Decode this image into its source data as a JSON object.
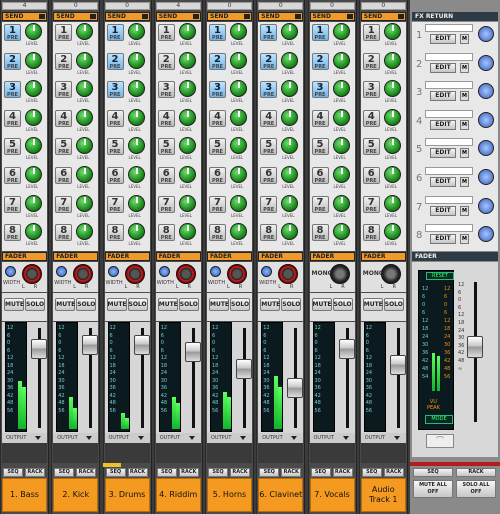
{
  "channels": [
    {
      "top": "4",
      "name": "1. Bass",
      "pan": "width",
      "sends_on": [
        1,
        2,
        3
      ],
      "fader": 0.88,
      "meter": [
        0.45,
        0.4
      ]
    },
    {
      "top": "0",
      "name": "2. Kick",
      "pan": "width",
      "sends_on": [],
      "fader": 0.92,
      "meter": [
        0.3,
        0.2
      ]
    },
    {
      "top": "0",
      "name": "3. Drums",
      "pan": "width",
      "sends_on": [
        1,
        2,
        3
      ],
      "fader": 0.92,
      "meter": [
        0.15,
        0.1
      ]
    },
    {
      "top": "4",
      "name": "4. Riddim",
      "pan": "width",
      "sends_on": [],
      "fader": 0.85,
      "meter": [
        0.3,
        0.25
      ]
    },
    {
      "top": "0",
      "name": "5. Horns",
      "pan": "width",
      "sends_on": [
        1,
        2,
        3
      ],
      "fader": 0.66,
      "meter": [
        0.35,
        0.3
      ]
    },
    {
      "top": "0",
      "name": "6. Clavinet",
      "pan": "width",
      "sends_on": [
        1,
        2,
        3
      ],
      "fader": 0.45,
      "meter": [
        0.5,
        0.4
      ]
    },
    {
      "top": "0",
      "name": "7. Vocals",
      "pan": "mono",
      "sends_on": [
        1,
        2,
        3
      ],
      "fader": 0.88,
      "meter": [
        0,
        0
      ]
    },
    {
      "top": "0",
      "name": "Audio Track 1",
      "pan": "mono",
      "sends_on": [],
      "fader": 0.7,
      "meter": [
        0,
        0
      ]
    }
  ],
  "labels": {
    "send": "SEND",
    "fader": "FADER",
    "level": "LEVEL",
    "pre": "PRE",
    "width": "WIDTH",
    "mono": "MONO",
    "l": "L",
    "r": "R",
    "mute": "MUTE",
    "solo": "SOLO",
    "output": "OUTPUT",
    "seq": "SEQ",
    "rack": "RACK"
  },
  "meter_scale": [
    "12",
    "6",
    "0",
    "6",
    "12",
    "18",
    "24",
    "30",
    "36",
    "42",
    "48",
    "56"
  ],
  "fx_return": {
    "title": "FX RETURN",
    "edit": "EDIT",
    "m": "M",
    "rows": [
      "1",
      "2",
      "3",
      "4",
      "5",
      "6",
      "7",
      "8"
    ]
  },
  "master": {
    "title": "FADER",
    "reset": "RESET",
    "mode": "MODE",
    "vu": "VU",
    "peak": "PEAK",
    "scale_left": [
      "12",
      "6",
      "0",
      "6",
      "12",
      "18",
      "24",
      "30",
      "36",
      "42",
      "48",
      "54"
    ],
    "scale_right": [
      "12",
      "6",
      "0",
      "6",
      "12",
      "18",
      "24",
      "30",
      "36",
      "42",
      "48",
      "56"
    ],
    "fader_scale": [
      "12",
      "6",
      "0",
      "6",
      "12",
      "18",
      "24",
      "30",
      "36",
      "42",
      "48",
      "∞"
    ],
    "meter": [
      0.35,
      0.32
    ],
    "fader": 0.55,
    "mute_all": "MUTE ALL OFF",
    "solo_all": "SOLO ALL OFF",
    "seq": "SEQ",
    "rack": "RACK"
  },
  "colors": {
    "accent": "#f49a21",
    "send_on": "#6fb2e8",
    "knob": "#1e8f1e"
  }
}
